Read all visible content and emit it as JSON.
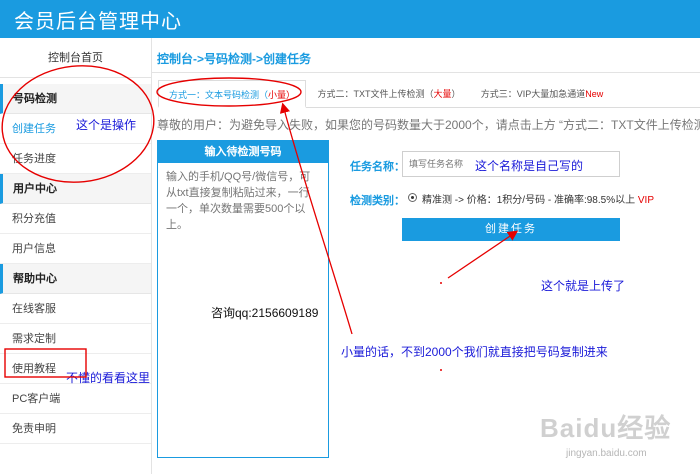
{
  "header": {
    "title": "会员后台管理中心"
  },
  "sidebar": {
    "home": "控制台首页",
    "sections": [
      {
        "title": "号码检测",
        "items": [
          "创建任务",
          "任务进度"
        ]
      },
      {
        "title": "用户中心",
        "items": [
          "积分充值",
          "用户信息"
        ]
      },
      {
        "title": "帮助中心",
        "items": [
          "在线客服",
          "需求定制",
          "使用教程",
          "PC客户端",
          "免责申明"
        ]
      }
    ]
  },
  "breadcrumb": "控制台->号码检测->创建任务",
  "tabs": [
    {
      "label": "方式一：文本号码检测（",
      "hi": "小量",
      "end": "）"
    },
    {
      "label": "方式二：TXT文件上传检测（",
      "hi": "大量",
      "end": "）"
    },
    {
      "label": "方式三：VIP大量加急通道",
      "hi": "New",
      "end": ""
    }
  ],
  "notice": "尊敬的用户：为避免导入失败，如果您的号码数量大于2000个，请点击上方 “方式二：TXT文件上传检测”",
  "input_panel": {
    "title": "输入待检测号码",
    "placeholder": "输入的手机/QQ号/微信号，可从txt直接复制粘贴过来，一行一个，单次数量需要500个以上。"
  },
  "form": {
    "task_name_label": "任务名称：",
    "task_name_placeholder": "填写任务名称",
    "detect_type_label": "检测类别：",
    "detect_option": "精准测 -> 价格：1积分/号码 - 准确率:98.5%以上 ",
    "detect_vip": "VIP",
    "create_button": "创建任务"
  },
  "annotations": {
    "op": "这个是操作",
    "name_note": "这个名称是自己写的",
    "upload_note": "这个就是上传了",
    "qq": "咨询qq:2156609189",
    "small_note": "小量的话，不到2000个我们就直接把号码复制进来",
    "tutorial_note": "不懂的看看这里"
  },
  "watermark": {
    "brand": "Baidu经验",
    "url": "jingyan.baidu.com"
  },
  "colors": {
    "primary": "#1a9be0",
    "annotation_red": "#e60000",
    "annotation_blue": "#1a1ad8"
  }
}
